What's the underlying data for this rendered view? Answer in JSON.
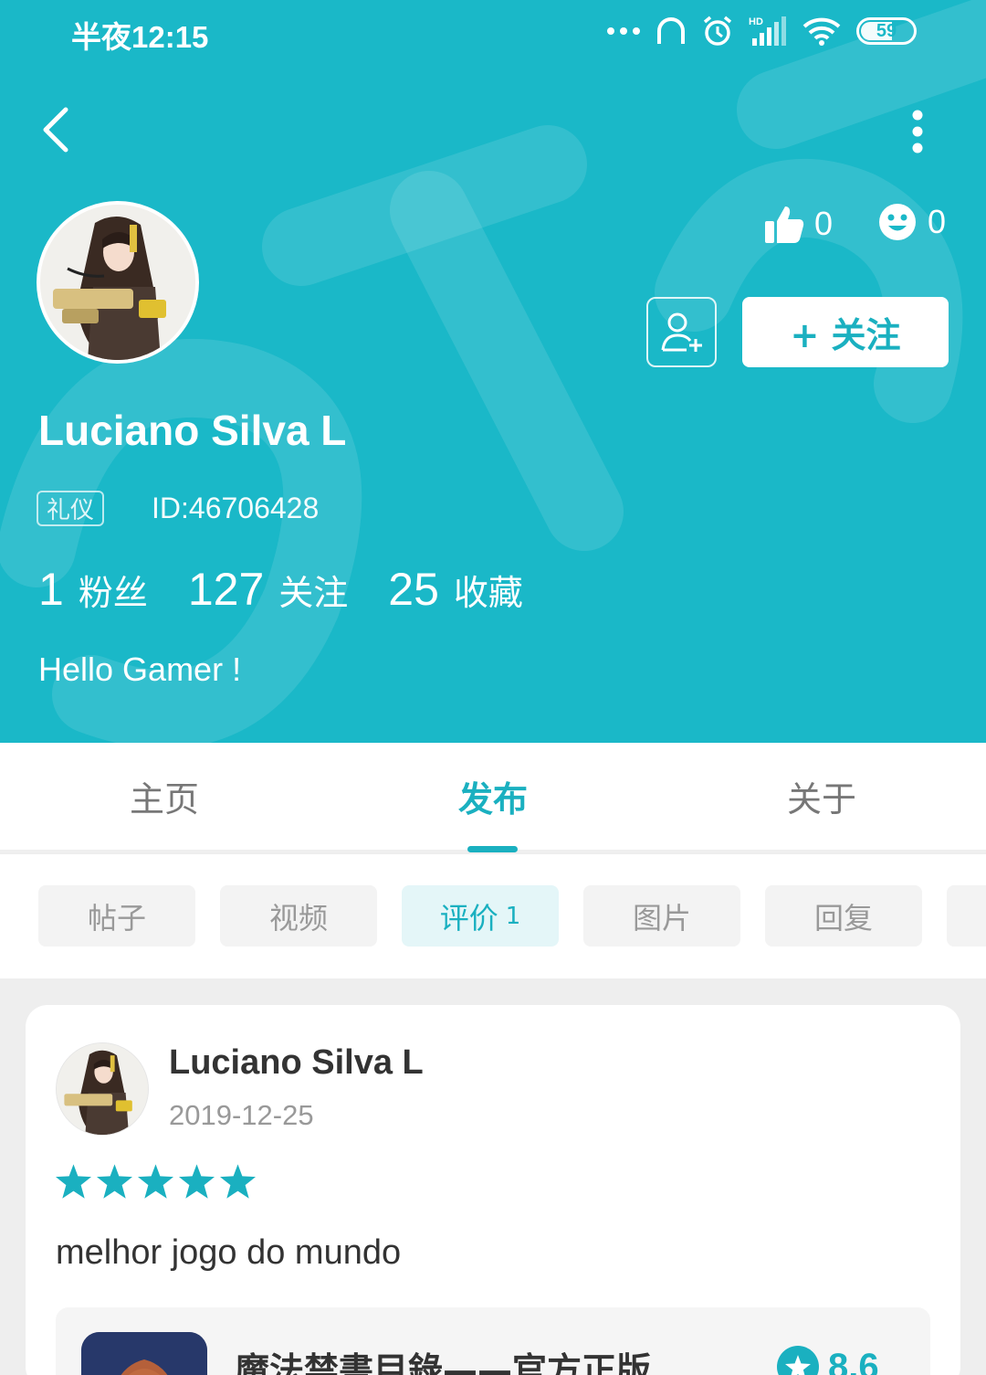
{
  "status_bar": {
    "time": "半夜12:15",
    "battery": "59"
  },
  "profile": {
    "likes": "0",
    "smiles": "0",
    "follow_label": "+ 关注",
    "username": "Luciano Silva L",
    "badge": "礼仪",
    "user_id": "ID:46706428",
    "stats": [
      {
        "value": "1",
        "label": "粉丝"
      },
      {
        "value": "127",
        "label": "关注"
      },
      {
        "value": "25",
        "label": "收藏"
      }
    ],
    "bio": "Hello Gamer !"
  },
  "tabs": [
    {
      "label": "主页"
    },
    {
      "label": "发布"
    },
    {
      "label": "关于"
    }
  ],
  "chips": [
    {
      "label": "帖子",
      "count": ""
    },
    {
      "label": "视频",
      "count": ""
    },
    {
      "label": "评价",
      "count": "1"
    },
    {
      "label": "图片",
      "count": ""
    },
    {
      "label": "回复",
      "count": ""
    }
  ],
  "review": {
    "author": "Luciano Silva L",
    "date": "2019-12-25",
    "rating": 5,
    "text": "melhor jogo do mundo",
    "game_title": "魔法禁書目錄——官方正版",
    "game_score": "8.6"
  },
  "colors": {
    "accent": "#1ab8c8",
    "accent_text": "#1ab0c0"
  },
  "icons": [
    "back-arrow-icon",
    "more-vertical-icon",
    "thumbs-up-icon",
    "smile-icon",
    "add-friend-icon",
    "star-icon"
  ]
}
